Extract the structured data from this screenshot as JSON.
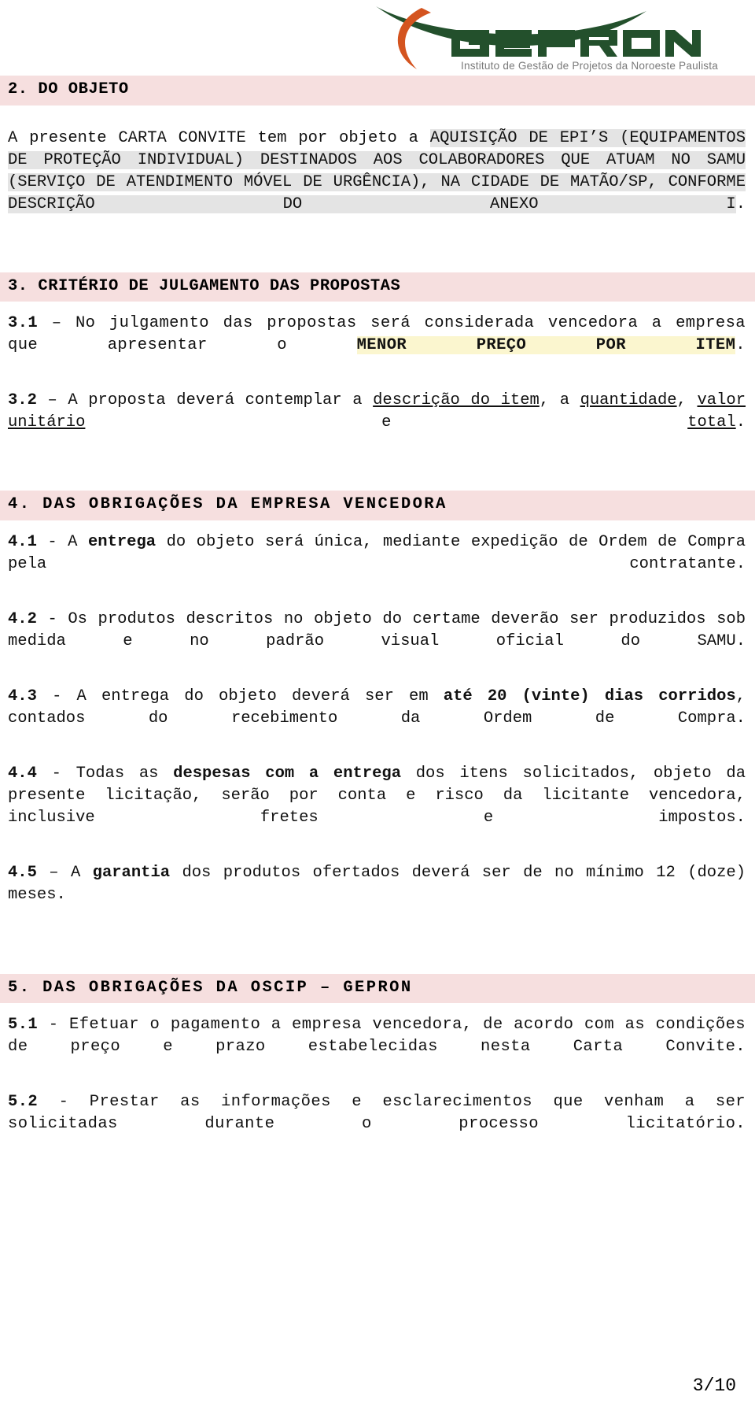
{
  "document": {
    "type": "carta-convite",
    "page_label": "3/10"
  },
  "logo": {
    "brand_name": "GEPRON",
    "tagline": "Instituto de Gestão de Projetos da Noroeste Paulista",
    "colors": {
      "green": "#23502c",
      "orange": "#d4541f",
      "tagline_gray": "#777777"
    }
  },
  "colors": {
    "heading_band": "#f6dfdf",
    "gray_highlight": "#e4e4e4",
    "yellow_highlight": "#fbf6cf",
    "text": "#111111"
  },
  "sections": [
    {
      "id": "sec2",
      "heading": "2. DO OBJETO",
      "body": {
        "t1": "A presente CARTA CONVITE tem por objeto a ",
        "hl1": "AQUISIÇÃO DE EPI’S (EQUIPAMENTOS DE PROTEÇÃO INDIVIDUAL) DESTINADOS AOS COLABORADORES QUE ATUAM NO SAMU (SERVIÇO DE ATENDIMENTO MÓVEL DE URGÊNCIA), NA CIDADE DE MATÃO/SP, CONFORME DESCRIÇÃO DO ANEXO I",
        "t2": "."
      }
    },
    {
      "id": "sec3",
      "heading": "3. CRITÉRIO DE JULGAMENTO DAS PROPOSTAS",
      "items": [
        {
          "num": "3.1",
          "dash": " – ",
          "t1": "No julgamento das propostas será considerada vencedora a empresa que apresentar o ",
          "hl1": "MENOR PREÇO POR ITEM",
          "t2": "."
        },
        {
          "num": "3.2",
          "dash": " – ",
          "t1": "A proposta deverá contemplar a ",
          "u1": "descrição do item",
          "t2": ", a ",
          "u2": "quantidade",
          "t3": ", ",
          "u3": "valor unitário",
          "t4": " e ",
          "u4": "total",
          "t5": "."
        }
      ]
    },
    {
      "id": "sec4",
      "heading": "4. DAS OBRIGAÇÕES DA EMPRESA VENCEDORA",
      "items": [
        {
          "num": "4.1",
          "dash": " - ",
          "t1": "A ",
          "b1": "entrega",
          "t2": " do objeto será única, mediante expedição de Ordem de Compra pela contratante."
        },
        {
          "num": "4.2",
          "dash": " - ",
          "t1": "Os produtos descritos no objeto do certame deverão ser produzidos sob medida e no padrão visual oficial do SAMU."
        },
        {
          "num": "4.3",
          "dash": " - ",
          "t1": "A entrega do objeto deverá ser em ",
          "b1": "até 20 (vinte) dias corridos",
          "t2": ", contados do recebimento da Ordem de Compra."
        },
        {
          "num": "4.4",
          "dash": " - ",
          "t1": "Todas as ",
          "b1": "despesas com a entrega",
          "t2": " dos itens solicitados, objeto da presente licitação, serão por conta e risco da licitante vencedora, inclusive fretes e impostos."
        },
        {
          "num": "4.5",
          "dash": " – ",
          "t1": "A ",
          "b1": "garantia",
          "t2": " dos produtos ofertados deverá ser de no mínimo 12 (doze) meses."
        }
      ]
    },
    {
      "id": "sec5",
      "heading": "5. DAS OBRIGAÇÕES DA OSCIP – GEPRON",
      "items": [
        {
          "num": "5.1",
          "dash": " - ",
          "t1": "Efetuar o pagamento a empresa vencedora, de acordo com as condições de preço e prazo estabelecidas nesta Carta Convite."
        },
        {
          "num": "5.2",
          "dash": " - ",
          "t1": "Prestar as informações e esclarecimentos que venham a ser solicitadas durante o processo licitatório."
        }
      ]
    }
  ]
}
